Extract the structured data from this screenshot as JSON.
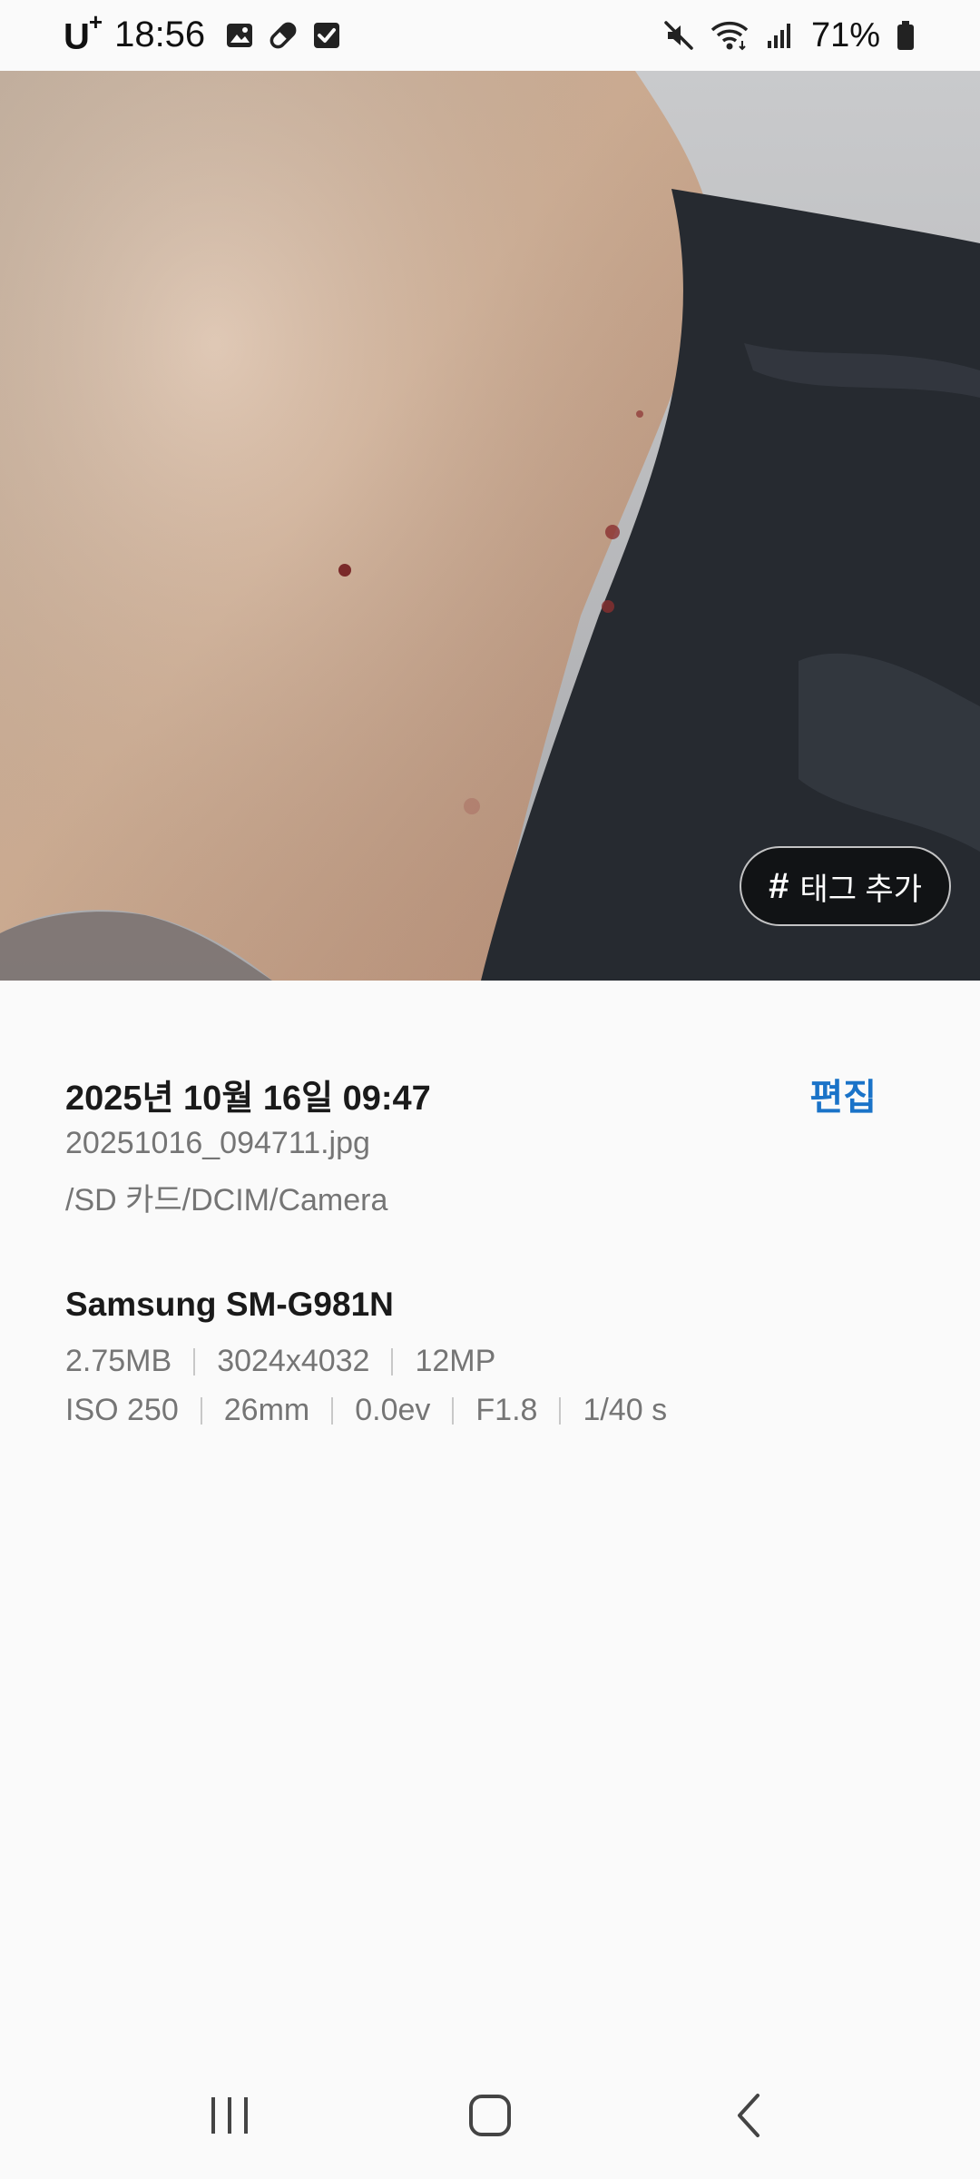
{
  "status_bar": {
    "carrier": "U",
    "carrier_mark": "+",
    "time": "18:56",
    "left_icons": [
      "image-icon",
      "pill-icon",
      "checkbox-icon"
    ],
    "right_icons": [
      "mute-icon",
      "wifi-icon",
      "signal-icon",
      "battery-icon"
    ],
    "battery_percent": "71%"
  },
  "photo": {
    "alt": "close-up photo of skin",
    "tag_button_hash": "#",
    "tag_button_label": "태그 추가"
  },
  "details": {
    "date": "2025년 10월 16일 09:47",
    "edit_label": "편집",
    "filename": "20251016_094711.jpg",
    "path": "/SD 카드/DCIM/Camera",
    "device": "Samsung SM-G981N",
    "file_info": [
      "2.75MB",
      "3024x4032",
      "12MP"
    ],
    "camera_info": [
      "ISO 250",
      "26mm",
      "0.0ev",
      "F1.8",
      "1/40 s"
    ]
  },
  "nav_bar": {
    "buttons": [
      "recent-apps-icon",
      "home-icon",
      "back-icon"
    ]
  },
  "colors": {
    "accent": "#1a73c8",
    "secondary_text": "#757575",
    "background": "#fafafa"
  }
}
